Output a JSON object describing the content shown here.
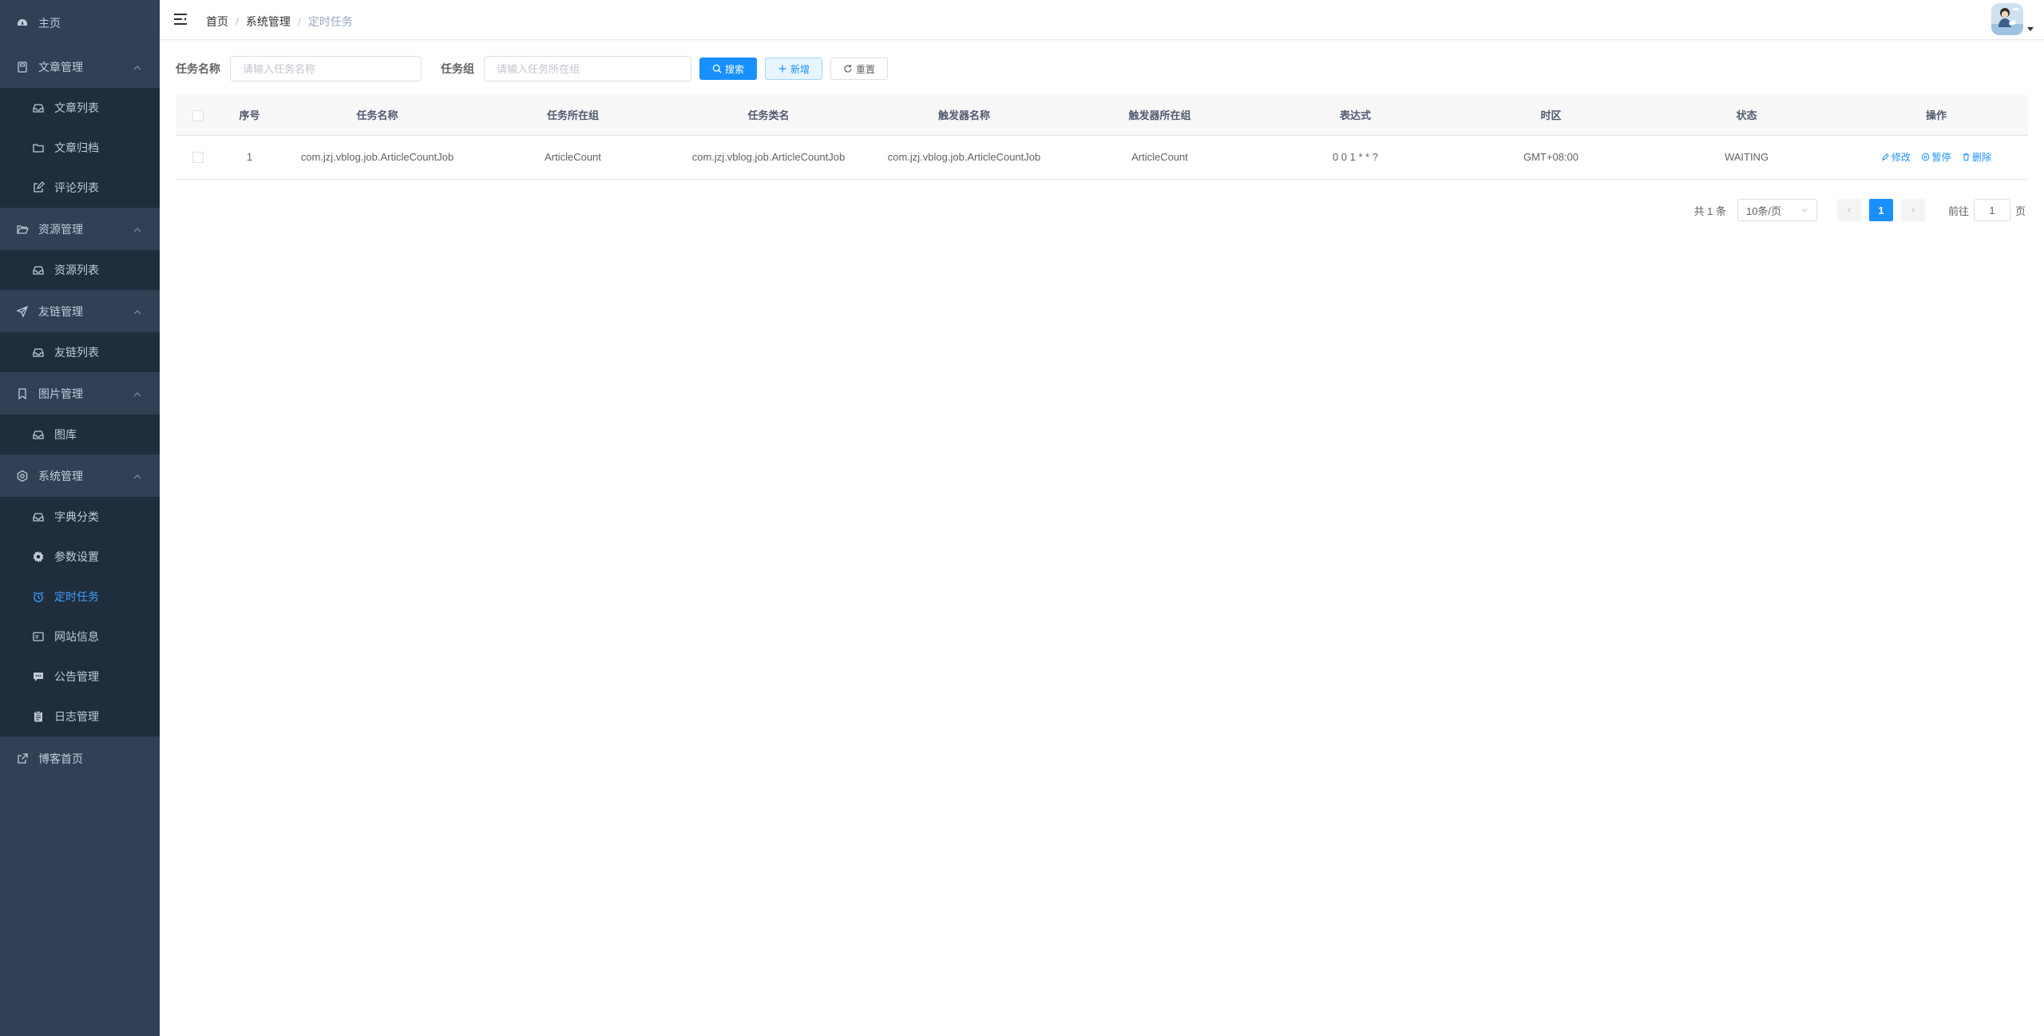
{
  "sidebar": {
    "home": "主页",
    "article_group": "文章管理",
    "article_list": "文章列表",
    "article_archive": "文章归档",
    "comment_list": "评论列表",
    "resource_group": "资源管理",
    "resource_list": "资源列表",
    "friendlink_group": "友链管理",
    "friendlink_list": "友链列表",
    "image_group": "图片管理",
    "gallery": "图库",
    "system_group": "系统管理",
    "dict_category": "字典分类",
    "param_settings": "参数设置",
    "scheduled_tasks": "定时任务",
    "site_info": "网站信息",
    "notice_manage": "公告管理",
    "log_manage": "日志管理",
    "blog_home": "博客首页"
  },
  "breadcrumb": [
    "首页",
    "系统管理",
    "定时任务"
  ],
  "search": {
    "task_name_label": "任务名称",
    "task_name_placeholder": "请输入任务名称",
    "task_group_label": "任务组",
    "task_group_placeholder": "请输入任务所在组",
    "search_label": "搜索",
    "add_label": "新增",
    "reset_label": "重置"
  },
  "table": {
    "headers": [
      "序号",
      "任务名称",
      "任务所在组",
      "任务类名",
      "触发器名称",
      "触发器所在组",
      "表达式",
      "时区",
      "状态",
      "操作"
    ],
    "rows": [
      [
        "1",
        "com.jzj.vblog.job.ArticleCountJob",
        "ArticleCount",
        "com.jzj.vblog.job.ArticleCountJob",
        "com.jzj.vblog.job.ArticleCountJob",
        "ArticleCount",
        "0 0 1 * * ?",
        "GMT+08:00",
        "WAITING"
      ]
    ],
    "actions": {
      "edit": "修改",
      "pause": "暂停",
      "delete": "删除"
    }
  },
  "pagination": {
    "total": "共 1 条",
    "page_size": "10条/页",
    "current_page": "1",
    "goto_label": "前往",
    "goto_value": "1",
    "page_suffix": "页"
  },
  "colors": {
    "sidebar_bg": "#304156",
    "submenu_bg": "#1f2d3d",
    "sidebar_text": "#bfcbd9",
    "accent": "#1890ff",
    "active_menu": "#409eff"
  }
}
